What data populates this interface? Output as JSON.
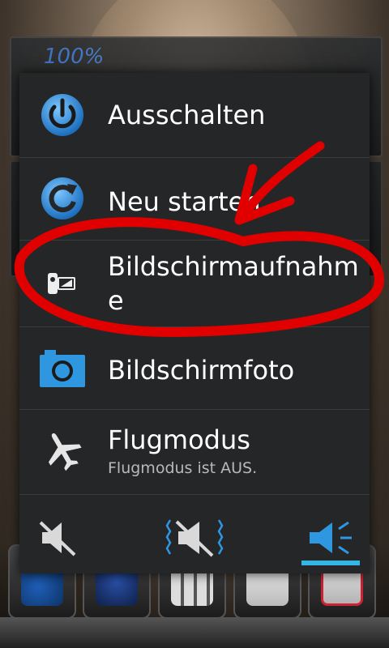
{
  "power_menu": {
    "items": [
      {
        "label": "Ausschalten",
        "icon": "power-icon"
      },
      {
        "label": "Neu starten",
        "icon": "restart-icon"
      },
      {
        "label": "Bildschirmaufnahme",
        "icon": "screen-record-icon"
      },
      {
        "label": "Bildschirmfoto",
        "icon": "camera-icon"
      },
      {
        "label": "Flugmodus",
        "sublabel": "Flugmodus ist AUS.",
        "icon": "airplane-icon"
      }
    ],
    "sound_modes": [
      {
        "name": "silent",
        "icon": "volume-mute-icon",
        "selected": false
      },
      {
        "name": "vibrate",
        "icon": "vibrate-icon",
        "selected": false
      },
      {
        "name": "sound-on",
        "icon": "volume-on-icon",
        "selected": true
      }
    ]
  },
  "background": {
    "widget_text": "100%"
  },
  "colors": {
    "accent": "#33b5e5",
    "icon_blue": "#2f8fd6",
    "dialog_bg": "#252627",
    "annotation_red": "#e00000"
  }
}
